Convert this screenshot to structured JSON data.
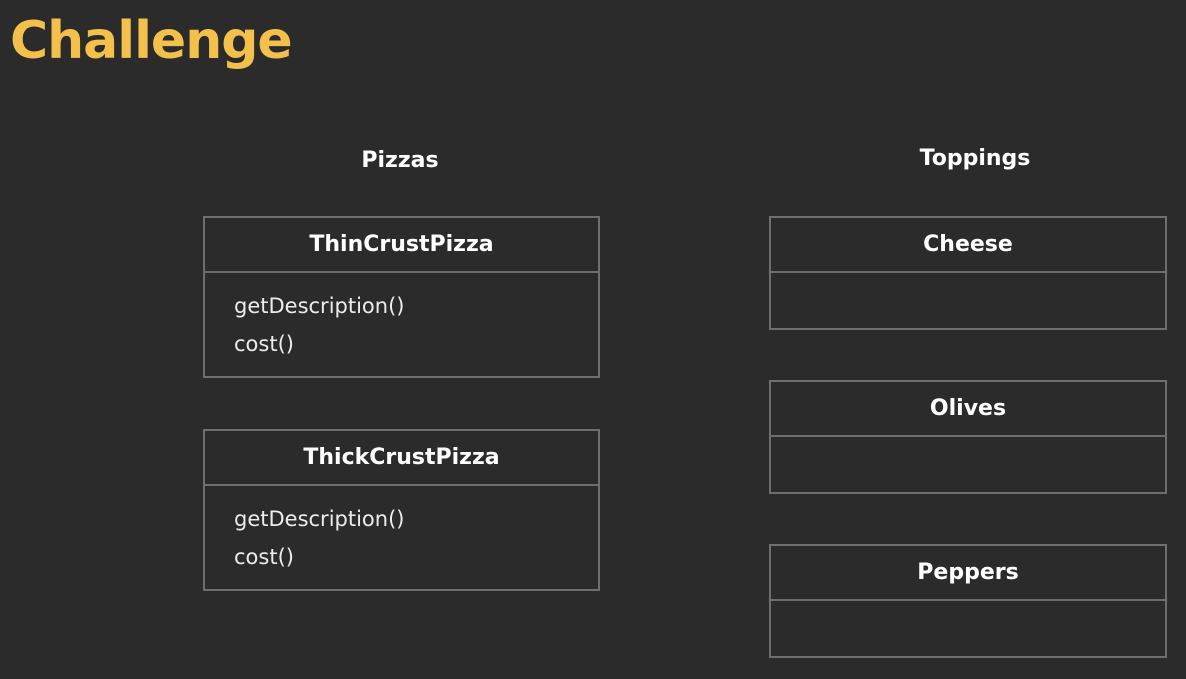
{
  "slide": {
    "title": "Challenge",
    "title_color": "#f2c04b",
    "background_color": "#2b2b2b"
  },
  "pizzas": {
    "heading": "Pizzas",
    "classes": [
      {
        "name": "ThinCrustPizza",
        "methods": [
          "getDescription()",
          "cost()"
        ]
      },
      {
        "name": "ThickCrustPizza",
        "methods": [
          "getDescription()",
          "cost()"
        ]
      }
    ]
  },
  "toppings": {
    "heading": "Toppings",
    "classes": [
      {
        "name": "Cheese"
      },
      {
        "name": "Olives"
      },
      {
        "name": "Peppers"
      }
    ]
  }
}
